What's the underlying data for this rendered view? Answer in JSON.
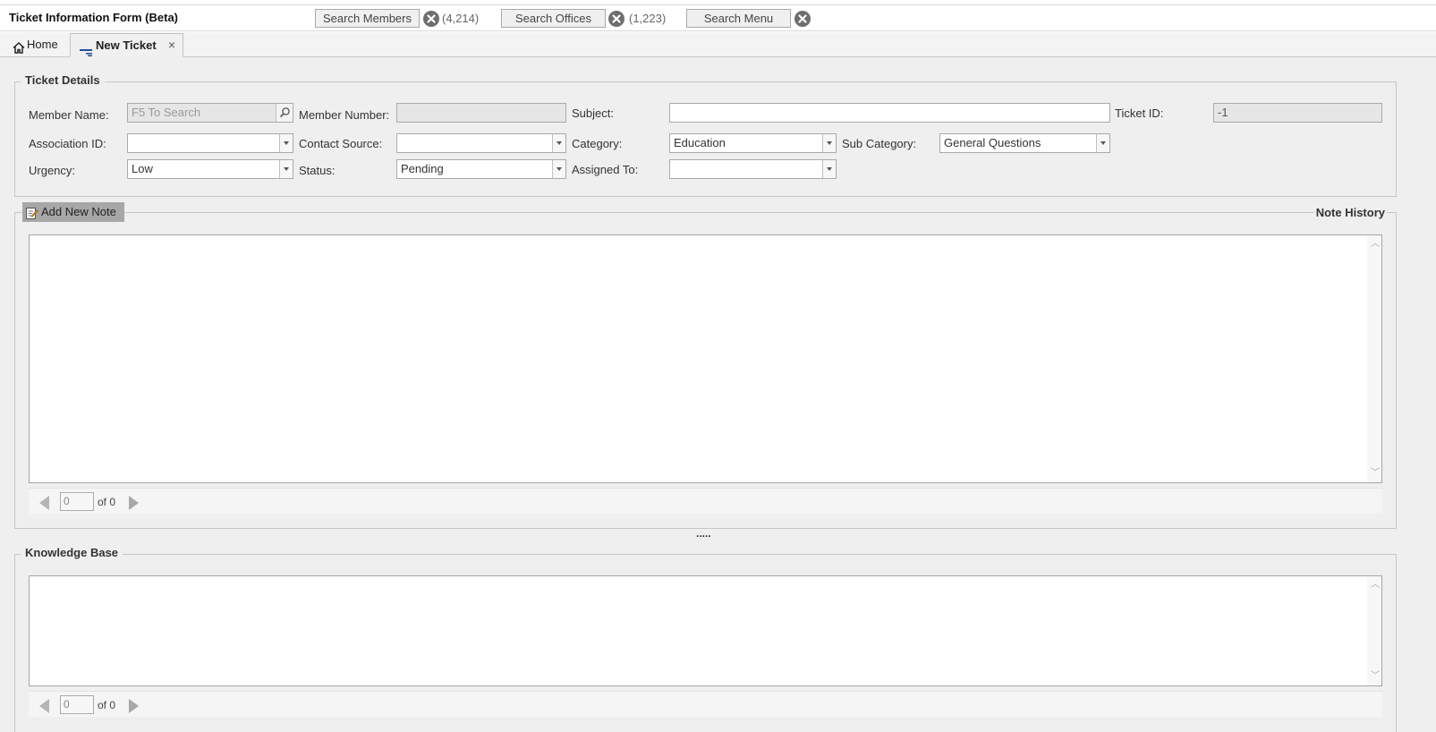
{
  "app": {
    "title": "Ticket Information Form (Beta)"
  },
  "toolbar": {
    "search_members": {
      "label": "Search Members",
      "count": "(4,214)"
    },
    "search_offices": {
      "label": "Search Offices",
      "count": "(1,223)"
    },
    "search_menu": {
      "label": "Search Menu"
    }
  },
  "tabs": [
    {
      "label": "Home",
      "icon": "home-icon"
    },
    {
      "label": "New Ticket",
      "icon": "ticket-icon",
      "close": "×",
      "active": true
    }
  ],
  "ticket_details": {
    "legend": "Ticket Details",
    "member_name": {
      "label": "Member Name:",
      "placeholder": "F5 To Search"
    },
    "member_number": {
      "label": "Member Number:",
      "value": ""
    },
    "subject": {
      "label": "Subject:",
      "value": ""
    },
    "ticket_id": {
      "label": "Ticket ID:",
      "value": "-1"
    },
    "association_id": {
      "label": "Association ID:",
      "value": ""
    },
    "contact_source": {
      "label": "Contact Source:",
      "value": ""
    },
    "category": {
      "label": "Category:",
      "value": "Education"
    },
    "sub_category": {
      "label": "Sub Category:",
      "value": "General Questions"
    },
    "urgency": {
      "label": "Urgency:",
      "value": "Low"
    },
    "status": {
      "label": "Status:",
      "value": "Pending"
    },
    "assigned_to": {
      "label": "Assigned To:",
      "value": ""
    }
  },
  "notes": {
    "add_label": "Add New Note",
    "history_label": "Note History",
    "pager": {
      "page": "0",
      "of_text": "of 0"
    }
  },
  "splitter": ".....",
  "knowledge_base": {
    "legend": "Knowledge Base",
    "pager": {
      "page": "0",
      "of_text": "of 0"
    }
  },
  "colors": {
    "accent": "#1f4e99",
    "clear_icon": "#6e6e6e",
    "panel_bg": "#efefef"
  }
}
